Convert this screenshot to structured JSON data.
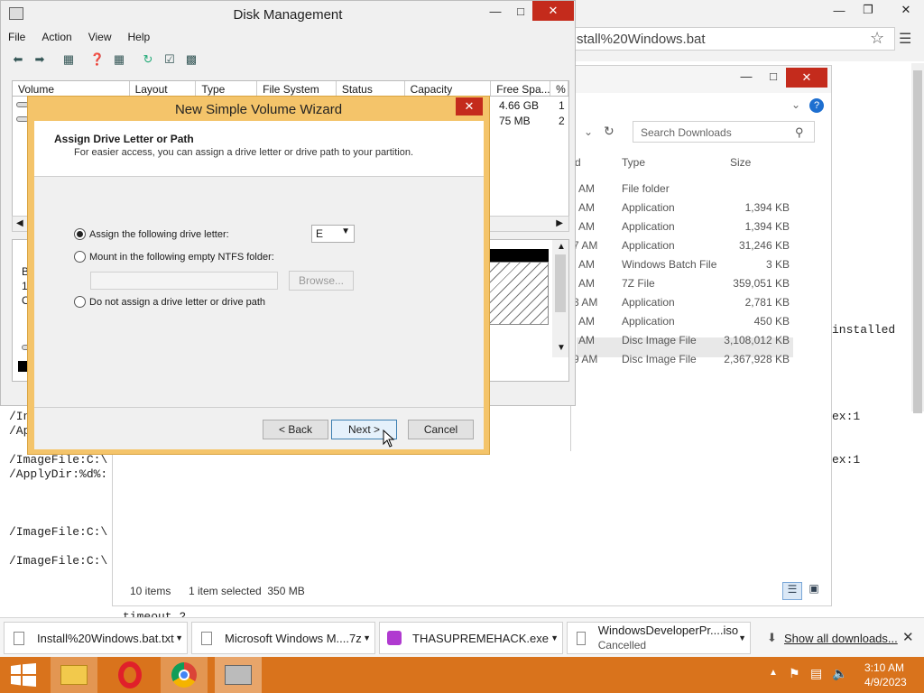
{
  "background_console": {
    "lines": [
      "/Ins",
      "/App",
      "/ImageFile:C:\\",
      "/ApplyDir:%d%:",
      "/ImageFile:C:\\",
      "/ImageFile:C:\\"
    ],
    "right_text": [
      "installed",
      "ex:1",
      "ex:1"
    ],
    "bottom_line": "timeout 2"
  },
  "browser": {
    "address": "stall%20Windows.bat"
  },
  "explorer": {
    "search_placeholder": "Search Downloads",
    "columns": {
      "type": "Type",
      "size": "Size",
      "date_fragment": "d"
    },
    "rows": [
      {
        "time": "AM",
        "type": "File folder",
        "size": ""
      },
      {
        "time": "AM",
        "type": "Application",
        "size": "1,394 KB"
      },
      {
        "time": "AM",
        "type": "Application",
        "size": "1,394 KB"
      },
      {
        "time": "7 AM",
        "type": "Application",
        "size": "31,246 KB"
      },
      {
        "time": "AM",
        "type": "Windows Batch File",
        "size": "3 KB"
      },
      {
        "time": "AM",
        "type": "7Z File",
        "size": "359,051 KB"
      },
      {
        "time": "3 AM",
        "type": "Application",
        "size": "2,781 KB"
      },
      {
        "time": "AM",
        "type": "Application",
        "size": "450 KB"
      },
      {
        "time": "AM",
        "type": "Disc Image File",
        "size": "3,108,012 KB"
      },
      {
        "time": "9 AM",
        "type": "Disc Image File",
        "size": "2,367,928 KB"
      }
    ],
    "item_count": "10 items",
    "selection": "1 item selected  350 MB"
  },
  "disk_management": {
    "title": "Disk Management",
    "menu": [
      "File",
      "Action",
      "View",
      "Help"
    ],
    "columns": [
      "Volume",
      "Layout",
      "Type",
      "File System",
      "Status",
      "Capacity",
      "Free Spa...",
      "%"
    ],
    "free_space": [
      "4.66 GB",
      "75 MB"
    ],
    "percent_fragments": [
      "1",
      "2"
    ],
    "disk_labels": [
      "B",
      "1(",
      "O"
    ]
  },
  "wizard": {
    "title": "New Simple Volume Wizard",
    "heading": "Assign Drive Letter or Path",
    "subheading": "For easier access, you can assign a drive letter or drive path to your partition.",
    "option_assign": "Assign the following drive letter:",
    "drive_letter": "E",
    "option_mount": "Mount in the following empty NTFS folder:",
    "browse": "Browse...",
    "option_none": "Do not assign a drive letter or drive path",
    "back": "< Back",
    "next": "Next >",
    "cancel": "Cancel"
  },
  "downloads_bar": {
    "items": [
      {
        "name": "Install%20Windows.bat.txt"
      },
      {
        "name": "Microsoft Windows M....7z"
      },
      {
        "name": "THASUPREMEHACK.exe"
      },
      {
        "name": "WindowsDeveloperPr....iso",
        "status": "Cancelled"
      }
    ],
    "show_all": "Show all downloads..."
  },
  "taskbar": {
    "time": "3:10 AM",
    "date": "4/9/2023"
  },
  "colors": {
    "taskbar": "#d9731c",
    "wizard_frame": "#f4c46a",
    "close_red": "#c42b1c"
  }
}
